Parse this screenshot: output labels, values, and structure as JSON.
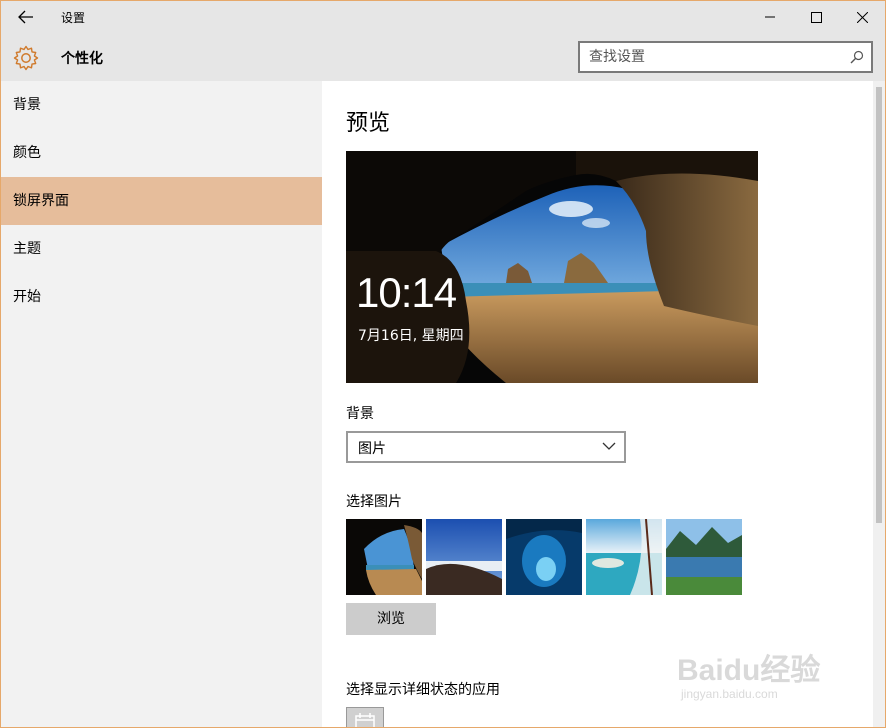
{
  "window": {
    "app_title": "设置"
  },
  "header": {
    "section_title": "个性化",
    "search_placeholder": "查找设置"
  },
  "sidebar": {
    "items": [
      {
        "label": "背景"
      },
      {
        "label": "颜色"
      },
      {
        "label": "锁屏界面",
        "active": true
      },
      {
        "label": "主题"
      },
      {
        "label": "开始"
      }
    ]
  },
  "main": {
    "page_title": "预览",
    "preview": {
      "time": "10:14",
      "date": "7月16日, 星期四"
    },
    "background_label": "背景",
    "background_value": "图片",
    "choose_picture_label": "选择图片",
    "browse_label": "浏览",
    "detail_app_label": "选择显示详细状态的应用"
  },
  "watermark": {
    "text": "Baidu经验",
    "sub": "jingyan.baidu.com"
  },
  "colors": {
    "accent": "#e6bd9b",
    "titlebar": "#e6e6e6",
    "sidebar": "#f2f2f2",
    "border": "#e6a86a"
  }
}
